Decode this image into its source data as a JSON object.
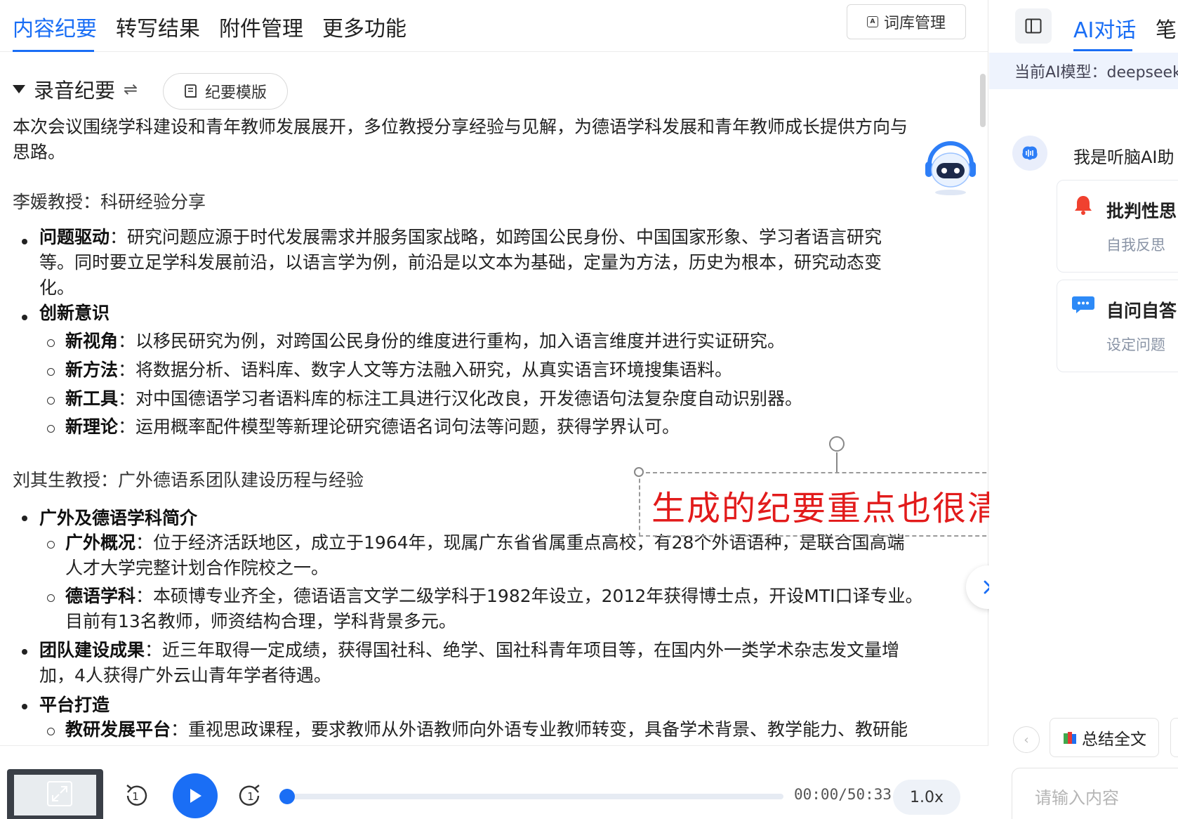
{
  "tabs": [
    "内容纪要",
    "转写结果",
    "附件管理",
    "更多功能"
  ],
  "lexicon_button": "词库管理",
  "section": {
    "title": "录音纪要",
    "swap_symbol": "⇌",
    "template_button": "纪要模版"
  },
  "summary_paragraph": [
    "本次会议围绕学科建设和青年教师发展展开，多位教授分享经验与见解，为德语学科发展和青年教师成长提供方向与",
    "思路。"
  ],
  "speaker1": "李媛教授：科研经验分享",
  "s1_items": [
    {
      "label": "问题驱动",
      "lines": [
        "：研究问题应源于时代发展需求并服务国家战略，如跨国公民身份、中国国家形象、学习者语言研究",
        "等。同时要立足学科发展前沿，以语言学为例，前沿是以文本为基础，定量为方法，历史为根本，研究动态变",
        "化。"
      ]
    },
    {
      "label": "创新意识",
      "lines": [
        ""
      ]
    }
  ],
  "s1_sub": [
    {
      "label": "新视角",
      "text": "：以移民研究为例，对跨国公民身份的维度进行重构，加入语言维度并进行实证研究。"
    },
    {
      "label": "新方法",
      "text": "：将数据分析、语料库、数字人文等方法融入研究，从真实语言环境搜集语料。"
    },
    {
      "label": "新工具",
      "text": "：对中国德语学习者语料库的标注工具进行汉化改良，开发德语句法复杂度自动识别器。"
    },
    {
      "label": "新理论",
      "text": "：运用概率配件模型等新理论研究德语名词句法等问题，获得学界认可。"
    }
  ],
  "speaker2": "刘其生教授：广外德语系团队建设历程与经验",
  "s2_head1": "广外及德语学科简介",
  "s2_sub": [
    {
      "label": "广外概况",
      "lines": [
        "：位于经济活跃地区，成立于1964年，现属广东省省属重点高校，有28个外语语种，是联合国高端",
        "人才大学完整计划合作院校之一。"
      ]
    },
    {
      "label": "德语学科",
      "lines": [
        "：本硕博专业齐全，德语语言文学二级学科于1982年设立，2012年获得博士点，开设MTI口译专业。",
        "目前有13名教师，师资结构合理，学科背景多元。"
      ]
    }
  ],
  "s2_team": {
    "label": "团队建设成果",
    "lines": [
      "：近三年取得一定成绩，获得国社科、绝学、国社科青年项目等，在国内外一类学术杂志发文量增",
      "加，4人获得广外云山青年学者待遇。"
    ]
  },
  "s2_platform": "平台打造",
  "s2_platform_sub": {
    "label": "教研发展平台",
    "text": "：重视思政课程，要求教师从外语教师向外语专业教师转变，具备学术背景、教学能力、教研能"
  },
  "annotation": "生成的纪要重点也很清晰",
  "player": {
    "time": "00:00/50:33",
    "speed": "1.0x",
    "rewind_seconds": "1",
    "forward_seconds": "1",
    "progress": 0
  },
  "right": {
    "tabs": [
      "AI对话",
      "笔"
    ],
    "model_label": "当前AI模型：deepseek",
    "greeting": "我是听脑AI助",
    "cards": [
      {
        "title": "批判性思",
        "sub": "自我反思 ",
        "icon": "bell-icon"
      },
      {
        "title": "自问自答",
        "sub": "设定问题 ",
        "icon": "chat-bubble-icon"
      }
    ],
    "summary_button": "总结全文",
    "input_placeholder": "请输入内容"
  },
  "colors": {
    "accent": "#1a6ef5",
    "annotation": "#e21b1b"
  }
}
